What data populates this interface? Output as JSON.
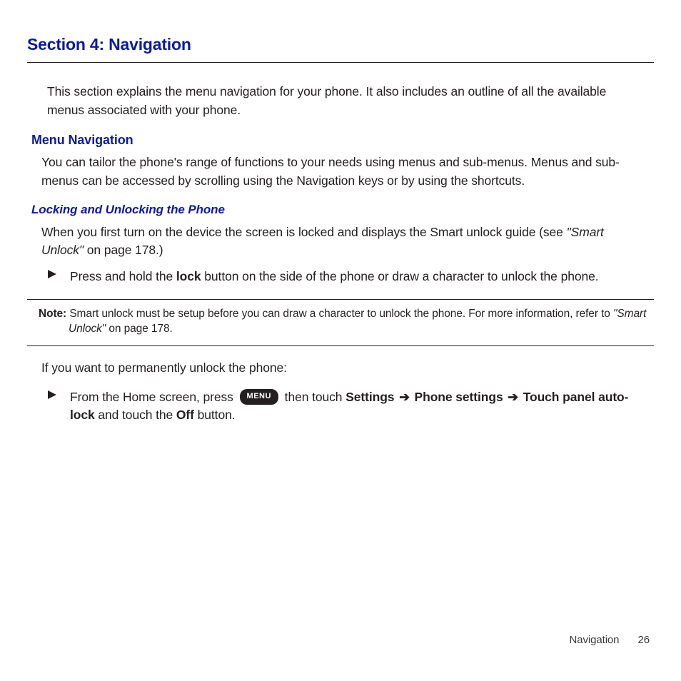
{
  "section_title": "Section 4: Navigation",
  "intro": "This section explains the menu navigation for your phone. It also includes an outline of all the available menus associated with your phone.",
  "h2_menu_nav": "Menu Navigation",
  "menu_nav_body": "You can tailor the phone's range of functions to your needs using menus and sub-menus. Menus and sub-menus can be accessed by scrolling using the Navigation keys or by using the shortcuts.",
  "h3_locking": "Locking and Unlocking the Phone",
  "locking_para_pre": "When you first turn on the device the screen is locked and displays the Smart unlock guide (see ",
  "locking_para_ref": "\"Smart Unlock\"",
  "locking_para_post": " on page 178.)",
  "bullet1_pre": "Press and hold the ",
  "bullet1_bold": "lock",
  "bullet1_post": " button on the side of the phone or draw a character to unlock the phone.",
  "note_label": "Note:",
  "note_body_pre": " Smart unlock must be setup before you can draw a character to unlock the phone. For more information, refer to ",
  "note_ref": "\"Smart Unlock\"",
  "note_body_post": " on page 178.",
  "after_note_para": "If you want to permanently unlock the phone:",
  "bullet2_pre": "From the Home screen, press ",
  "menu_pill": "MENU",
  "bullet2_mid1": " then touch ",
  "bold_settings": "Settings",
  "arrow": "➔",
  "bold_phone_settings": "Phone settings",
  "bold_touch_panel": "Touch panel auto-lock",
  "bullet2_mid2": " and touch the ",
  "bold_off": "Off",
  "bullet2_end": " button.",
  "footer_label": "Navigation",
  "footer_page": "26"
}
